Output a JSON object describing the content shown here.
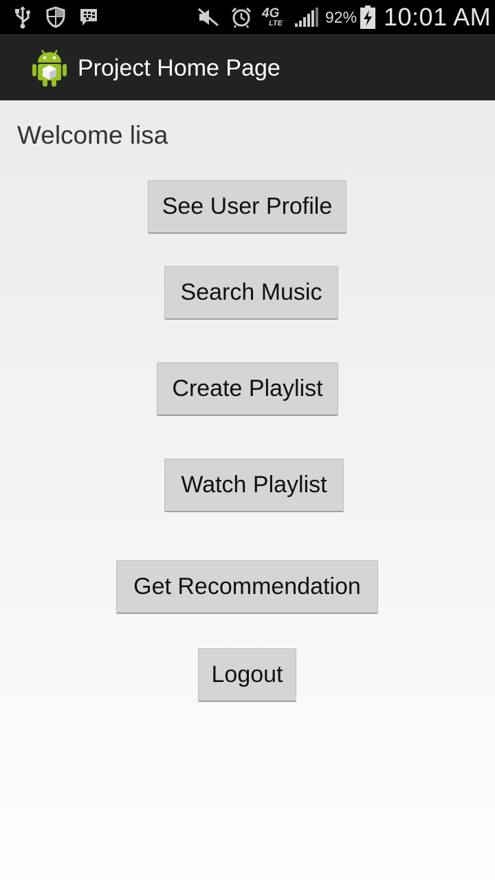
{
  "status_bar": {
    "icons": [
      "usb-icon",
      "shield-icon",
      "bbm-icon",
      "mute-icon",
      "alarm-icon",
      "4g-lte-icon",
      "signal-icon",
      "battery-charging-icon"
    ],
    "network_label": "4G",
    "network_sub_label": "LTE",
    "battery_percent": "92%",
    "time": "10:01 AM"
  },
  "action_bar": {
    "title": "Project Home Page",
    "icon": "android-app-icon"
  },
  "main": {
    "welcome_text": "Welcome lisa",
    "buttons": [
      {
        "label": "See User Profile"
      },
      {
        "label": "Search Music"
      },
      {
        "label": "Create Playlist"
      },
      {
        "label": "Watch Playlist"
      },
      {
        "label": "Get Recommendation"
      },
      {
        "label": "Logout"
      }
    ]
  },
  "colors": {
    "status_bar_bg": "#000000",
    "action_bar_bg": "#222222",
    "button_bg": "#d5d5d5",
    "android_green": "#97c024"
  }
}
